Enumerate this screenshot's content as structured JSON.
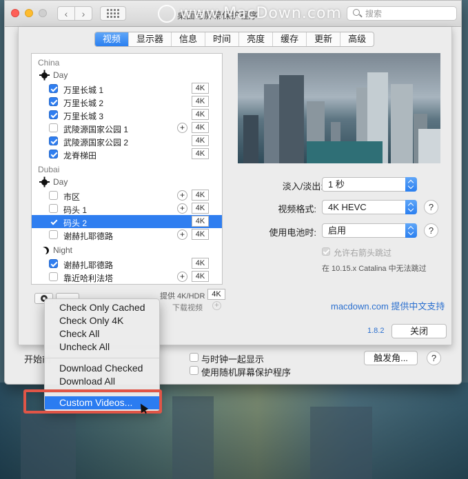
{
  "window": {
    "title": "桌面与屏幕保护程序",
    "watermark": "www.MacDown.com",
    "search_placeholder": "搜索",
    "grid_icon": "grid-icon"
  },
  "tabs": [
    "视频",
    "显示器",
    "信息",
    "时间",
    "亮度",
    "缓存",
    "更新",
    "高级"
  ],
  "active_tab": "视频",
  "groups": [
    {
      "name": "China",
      "sub": "Day",
      "items": [
        {
          "label": "万里长城 1",
          "checked": true,
          "badge": "4K",
          "plus": false
        },
        {
          "label": "万里长城 2",
          "checked": true,
          "badge": "4K",
          "plus": false
        },
        {
          "label": "万里长城 3",
          "checked": true,
          "badge": "4K",
          "plus": false
        },
        {
          "label": "武陵源国家公园 1",
          "checked": false,
          "badge": "4K",
          "plus": true
        },
        {
          "label": "武陵源国家公园 2",
          "checked": true,
          "badge": "4K",
          "plus": false
        },
        {
          "label": "龙脊梯田",
          "checked": true,
          "badge": "4K",
          "plus": false
        }
      ]
    },
    {
      "name": "Dubai",
      "sub": "Day",
      "items": [
        {
          "label": "市区",
          "checked": false,
          "badge": "4K",
          "plus": true
        },
        {
          "label": "码头 1",
          "checked": false,
          "badge": "4K",
          "plus": true
        },
        {
          "label": "码头 2",
          "checked": true,
          "badge": "4K",
          "plus": false,
          "selected": true
        },
        {
          "label": "谢赫扎耶德路",
          "checked": false,
          "badge": "4K",
          "plus": true
        }
      ]
    },
    {
      "sub": "Night",
      "items": [
        {
          "label": "谢赫扎耶德路",
          "checked": true,
          "badge": "4K",
          "plus": false
        },
        {
          "label": "靠近哈利法塔",
          "checked": false,
          "badge": "4K",
          "plus": true
        }
      ]
    }
  ],
  "list_footer": {
    "provide_label": "提供 4K/HDR",
    "provide_badge": "4K",
    "download_label": "下载视频"
  },
  "form": {
    "fade_label": "淡入/淡出:",
    "fade_value": "1 秒",
    "format_label": "视频格式:",
    "format_value": "4K HEVC",
    "battery_label": "使用电池时:",
    "battery_value": "启用",
    "arrow_skip_label": "允许右箭头跳过",
    "catalina_note": "在 10.15.x Catalina 中无法跳过",
    "help": "?"
  },
  "support_link": "macdown.com 提供中文支持",
  "version": "1.8.2",
  "close_button": "关闭",
  "bottom": {
    "start_label": "开始前",
    "clock_label": "与时钟一起显示",
    "random_label": "使用随机屏幕保护程序",
    "hot_corners": "触发角...",
    "help": "?"
  },
  "menu": {
    "group1": [
      "Check Only Cached",
      "Check Only 4K",
      "Check All",
      "Uncheck All"
    ],
    "group2": [
      "Download Checked",
      "Download All"
    ],
    "highlighted": "Custom Videos..."
  },
  "colors": {
    "accent": "#2f7ef0",
    "link": "#2a6fcf",
    "annotation": "#e05547"
  }
}
